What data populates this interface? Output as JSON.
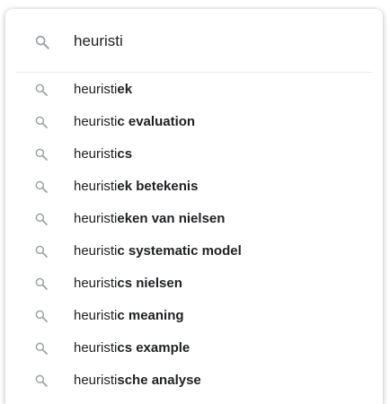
{
  "search": {
    "value": "heuristi",
    "icon": "search-icon"
  },
  "colors": {
    "icon": "#9aa0a6",
    "text": "#202124",
    "divider": "#e8eaed"
  },
  "suggestions": [
    {
      "prefix": "heuristi",
      "completion": "ek",
      "icon": "search-icon"
    },
    {
      "prefix": "heuristi",
      "completion": "c evaluation",
      "icon": "search-icon"
    },
    {
      "prefix": "heuristi",
      "completion": "cs",
      "icon": "search-icon"
    },
    {
      "prefix": "heuristi",
      "completion": "ek betekenis",
      "icon": "search-icon"
    },
    {
      "prefix": "heuristi",
      "completion": "eken van nielsen",
      "icon": "search-icon"
    },
    {
      "prefix": "heuristi",
      "completion": "c systematic model",
      "icon": "search-icon"
    },
    {
      "prefix": "heuristi",
      "completion": "cs nielsen",
      "icon": "search-icon"
    },
    {
      "prefix": "heuristi",
      "completion": "c meaning",
      "icon": "search-icon"
    },
    {
      "prefix": "heuristi",
      "completion": "cs example",
      "icon": "search-icon"
    },
    {
      "prefix": "heuristi",
      "completion": "sche analyse",
      "icon": "search-icon"
    }
  ]
}
